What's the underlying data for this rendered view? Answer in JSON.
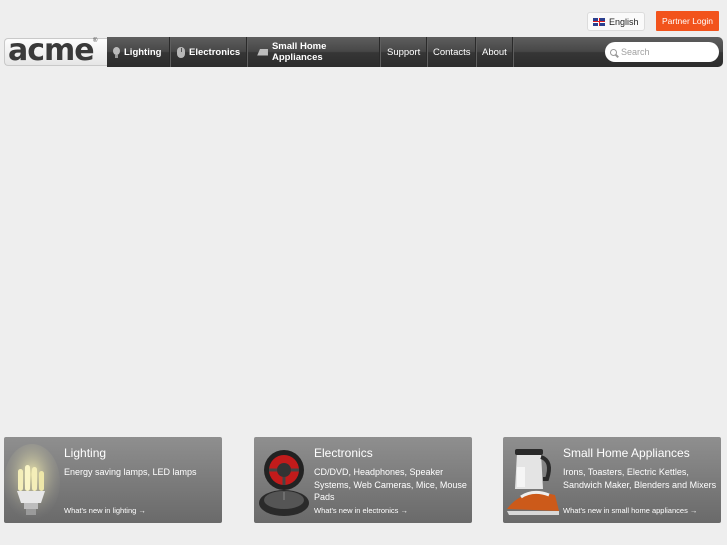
{
  "header": {
    "language": "English",
    "partner_login": "Partner Login",
    "logo": "acme",
    "logo_mark": "®"
  },
  "nav": {
    "items": [
      {
        "label": "Lighting",
        "icon": "bulb-icon"
      },
      {
        "label": "Electronics",
        "icon": "mouse-icon"
      },
      {
        "label": "Small Home Appliances",
        "icon": "iron-icon"
      },
      {
        "label": "Support"
      },
      {
        "label": "Contacts"
      },
      {
        "label": "About"
      }
    ],
    "search_placeholder": "Search"
  },
  "categories": [
    {
      "title": "Lighting",
      "description": "Energy saving lamps, LED lamps",
      "link": "What's new in lighting →"
    },
    {
      "title": "Electronics",
      "description": "CD/DVD, Headphones, Speaker Systems, Web Cameras, Mice, Mouse Pads",
      "link": "What's new in electronics →"
    },
    {
      "title": "Small Home Appliances",
      "description": "Irons, Toasters, Electric Kettles, Sandwich Maker, Blenders and Mixers",
      "link": "What's new in small home appliances →"
    }
  ],
  "colors": {
    "accent": "#f2531c",
    "page_bg": "#eeeeee",
    "nav_bg": "#3a3a3a"
  }
}
